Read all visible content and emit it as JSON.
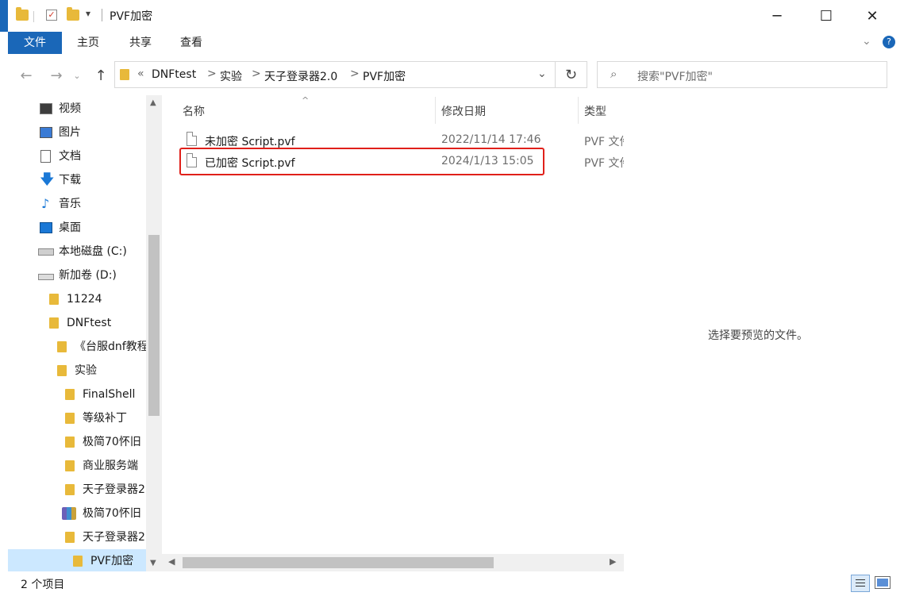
{
  "window": {
    "title": "PVF加密",
    "controls": {
      "minimize": "─",
      "maximize": "☐",
      "close": "✕"
    }
  },
  "ribbon": {
    "tabs": [
      {
        "label": "文件"
      },
      {
        "label": "主页"
      },
      {
        "label": "共享"
      },
      {
        "label": "查看"
      }
    ],
    "help": "?"
  },
  "address": {
    "overflow": "«",
    "crumbs": [
      "DNFtest",
      "实验",
      "天子登录器2.0",
      "PVF加密"
    ],
    "separator": ">",
    "search_placeholder": "搜索\"PVF加密\""
  },
  "nav": {
    "quick_items": [
      {
        "label": "视频",
        "icon": "video-icon"
      },
      {
        "label": "图片",
        "icon": "pictures-icon"
      },
      {
        "label": "文档",
        "icon": "documents-icon"
      },
      {
        "label": "下载",
        "icon": "download-icon"
      },
      {
        "label": "音乐",
        "icon": "music-icon"
      },
      {
        "label": "桌面",
        "icon": "desktop-icon"
      },
      {
        "label": "本地磁盘 (C:)",
        "icon": "drive-c-icon"
      },
      {
        "label": "新加卷 (D:)",
        "icon": "drive-d-icon"
      }
    ],
    "tree": [
      {
        "label": "11224"
      },
      {
        "label": "DNFtest"
      },
      {
        "label": "《台服dnf教程"
      },
      {
        "label": "实验"
      },
      {
        "label": "FinalShell"
      },
      {
        "label": "等级补丁"
      },
      {
        "label": "极简70怀旧"
      },
      {
        "label": "商业服务端"
      },
      {
        "label": "天子登录器2"
      },
      {
        "label": "极简70怀旧"
      },
      {
        "label": "天子登录器2"
      },
      {
        "label": "PVF加密"
      }
    ]
  },
  "columns": {
    "name": "名称",
    "date": "修改日期",
    "type": "类型"
  },
  "files": [
    {
      "name": "未加密 Script.pvf",
      "date": "2022/11/14 17:46",
      "type": "PVF 文件"
    },
    {
      "name": "已加密 Script.pvf",
      "date": "2024/1/13 15:05",
      "type": "PVF 文件"
    }
  ],
  "preview": {
    "message": "选择要预览的文件。"
  },
  "status": {
    "count": "2 个项目"
  },
  "colors": {
    "accent": "#1a67b8",
    "highlight_border": "#e0201a",
    "folder": "#e8b93a",
    "selected_nav": "#cce8ff"
  }
}
